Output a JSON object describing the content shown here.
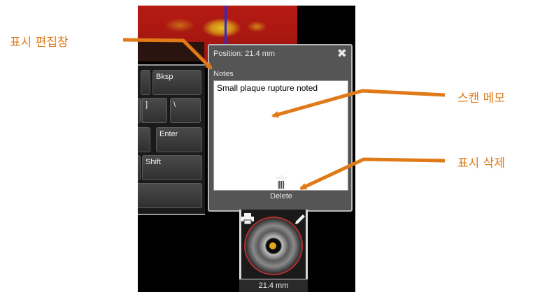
{
  "dialog": {
    "position_text": "Position: 21.4 mm",
    "notes_label": "Notes",
    "notes_value": "Small plaque rupture noted",
    "delete_label": "Delete"
  },
  "keyboard": {
    "keys": [
      "Bksp",
      "]",
      "\\",
      "Enter",
      "Shift"
    ]
  },
  "thumbnail": {
    "label": "21.4 mm"
  },
  "callouts": {
    "marker_edit_window": "표시 편집창",
    "scan_memo": "스캔 메모",
    "delete_marker": "표시 삭제"
  },
  "colors": {
    "callout": "#e07a18",
    "dialog_bg": "#555555",
    "heatmap": "#b61b12"
  },
  "icons": [
    "close-icon",
    "trash-icon",
    "print-icon",
    "pencil-icon"
  ]
}
